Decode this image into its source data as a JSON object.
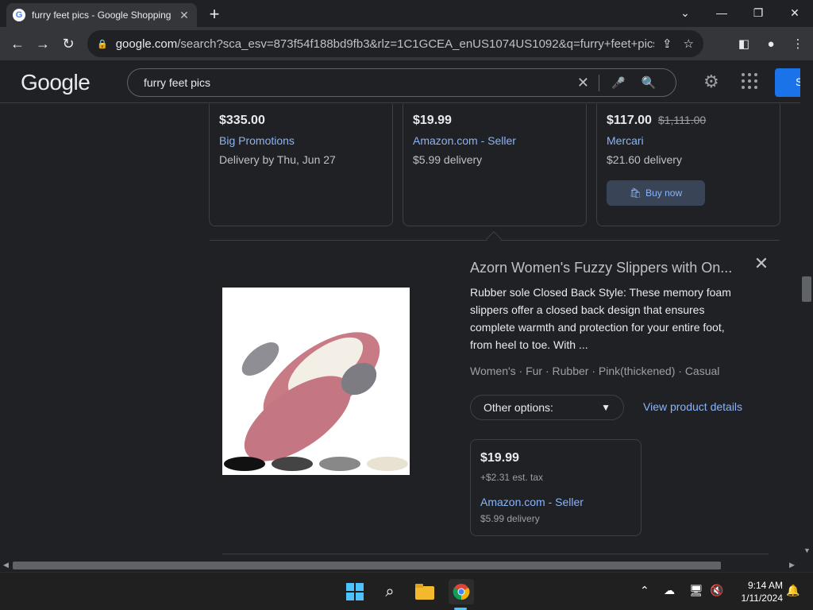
{
  "browser": {
    "tab_title": "furry feet pics - Google Shopping",
    "url_host": "google.com",
    "url_rest": "/search?sca_esv=873f54f188bd9fb3&rlz=1C1GCEA_enUS1074US1092&q=furry+feet+pics&tbm=sho..."
  },
  "google": {
    "logo": "Google",
    "query": "furry feet pics",
    "signin_label": "S"
  },
  "cards": [
    {
      "price": "$335.00",
      "orig_price": "",
      "seller": "Big Promotions",
      "delivery": "Delivery by Thu, Jun 27",
      "button": ""
    },
    {
      "price": "$19.99",
      "orig_price": "",
      "seller": "Amazon.com - Seller",
      "delivery": "$5.99 delivery",
      "button": ""
    },
    {
      "price": "$117.00",
      "orig_price": "$1,111.00",
      "seller": "Mercari",
      "delivery": "$21.60 delivery",
      "button": "Buy now"
    }
  ],
  "product": {
    "title": "Azorn Women's Fuzzy Slippers with On...",
    "description": "Rubber sole Closed Back Style: These memory foam slippers offer a closed back design that ensures complete warmth and protection for your entire foot, from heel to toe. With ...",
    "attributes": "Women's · Fur · Rubber · Pink(thickened) · Casual",
    "options_label": "Other options:",
    "view_details": "View product details",
    "offer": {
      "price": "$19.99",
      "tax": "+$2.31 est. tax",
      "seller": "Amazon.com - Seller",
      "delivery": "$5.99 delivery"
    }
  },
  "taskbar": {
    "time": "9:14 AM",
    "date": "1/11/2024"
  },
  "colors": {
    "link": "#8ab4f8",
    "background": "#202124",
    "accent": "#1a73e8"
  }
}
